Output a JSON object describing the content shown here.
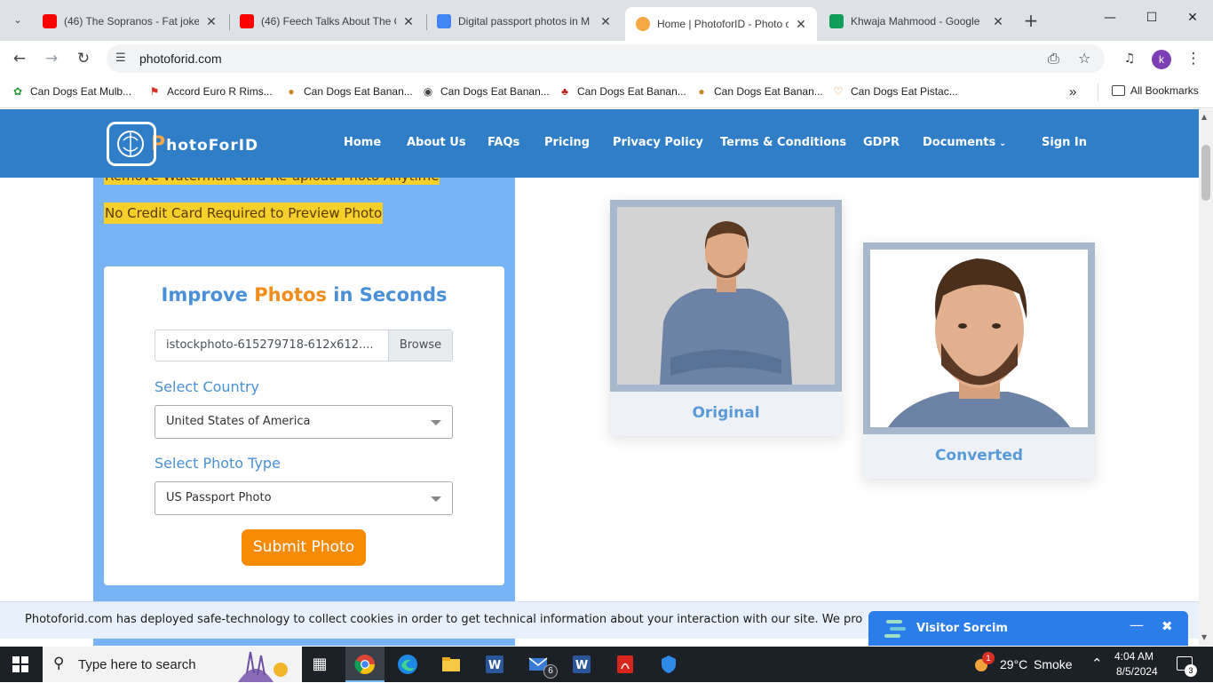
{
  "browser": {
    "tabs": [
      {
        "title": "(46) The Sopranos - Fat joke",
        "favicon": "youtube-icon",
        "active": false
      },
      {
        "title": "(46) Feech Talks About The C",
        "favicon": "youtube-icon",
        "active": false
      },
      {
        "title": "Digital passport photos in M",
        "favicon": "google-docs-icon",
        "active": false
      },
      {
        "title": "Home | PhotoforID - Photo c",
        "favicon": "photoforid-icon",
        "active": true
      },
      {
        "title": "Khwaja Mahmood - Google",
        "favicon": "google-sheets-icon",
        "active": false
      }
    ],
    "url": "photoforid.com",
    "profile_initial": "k"
  },
  "bookmarks": {
    "items": [
      {
        "label": "Can Dogs Eat Mulb...",
        "icon": "leaf-icon"
      },
      {
        "label": "Accord Euro R Rims...",
        "icon": "car-icon"
      },
      {
        "label": "Can Dogs Eat Banan...",
        "icon": "dog-icon"
      },
      {
        "label": "Can Dogs Eat Banan...",
        "icon": "globe-icon"
      },
      {
        "label": "Can Dogs Eat Banan...",
        "icon": "paw-icon"
      },
      {
        "label": "Can Dogs Eat Banan...",
        "icon": "dog-icon"
      },
      {
        "label": "Can Dogs Eat Pistac...",
        "icon": "heart-icon"
      }
    ],
    "all_bookmarks": "All Bookmarks"
  },
  "site": {
    "logo_first": "P",
    "logo_rest": "hotoForID",
    "nav": [
      "Home",
      "About Us",
      "FAQs",
      "Pricing",
      "Privacy Policy",
      "Terms & Conditions",
      "GDPR",
      "Documents",
      "Sign In"
    ],
    "highlight_1": "Remove Watermark and Re-upload Photo Anytime",
    "highlight_2": "No Credit Card Required to Preview Photo",
    "card": {
      "title_part1": "Improve ",
      "title_part2": "Photos",
      "title_part3": " in Seconds",
      "file_name": "istockphoto-615279718-612x612....",
      "browse": "Browse",
      "country_label": "Select Country",
      "country_value": "United States of America",
      "type_label": "Select Photo Type",
      "type_value": "US Passport Photo",
      "submit": "Submit Photo"
    },
    "original_label": "Original",
    "converted_label": "Converted",
    "cookie_text": "Photoforid.com has deployed safe-technology to collect cookies in order to get technical information about your interaction with our site. We pro",
    "chat_name": "Visitor Sorcim"
  },
  "taskbar": {
    "search_placeholder": "Type here to search",
    "mail_badge": "6",
    "weather_temp": "29°C",
    "weather_text": "Smoke",
    "weather_badge": "1",
    "time": "4:04 AM",
    "date": "8/5/2024",
    "notif_count": "3"
  },
  "colors": {
    "header_blue": "#2f7ec7",
    "panel_blue": "#78b4f5",
    "accent_orange": "#f78b06",
    "highlight_yellow": "#f5cf2a"
  }
}
